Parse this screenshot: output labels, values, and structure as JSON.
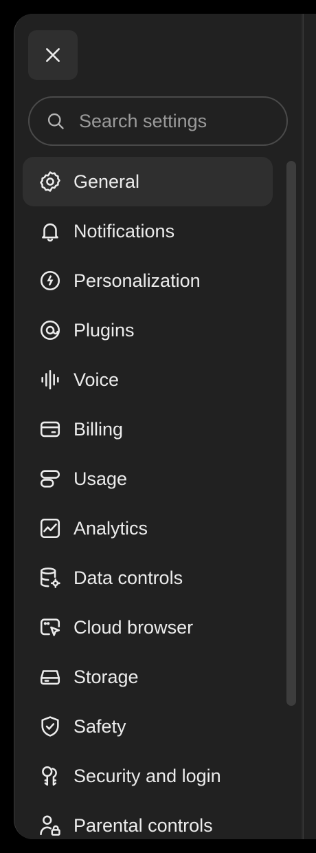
{
  "close_button": {
    "icon": "close-icon"
  },
  "search": {
    "placeholder": "Search settings",
    "value": "",
    "icon": "search-icon"
  },
  "nav": {
    "items": [
      {
        "label": "General",
        "icon": "gear-icon",
        "active": true
      },
      {
        "label": "Notifications",
        "icon": "bell-icon"
      },
      {
        "label": "Personalization",
        "icon": "personalization-icon"
      },
      {
        "label": "Plugins",
        "icon": "plugin-icon"
      },
      {
        "label": "Voice",
        "icon": "waveform-icon"
      },
      {
        "label": "Billing",
        "icon": "card-icon"
      },
      {
        "label": "Usage",
        "icon": "usage-icon"
      },
      {
        "label": "Analytics",
        "icon": "chart-icon"
      },
      {
        "label": "Data controls",
        "icon": "database-gear-icon"
      },
      {
        "label": "Cloud browser",
        "icon": "browser-cursor-icon"
      },
      {
        "label": "Storage",
        "icon": "drive-icon"
      },
      {
        "label": "Safety",
        "icon": "shield-check-icon"
      },
      {
        "label": "Security and login",
        "icon": "keys-icon"
      },
      {
        "label": "Parental controls",
        "icon": "person-lock-icon"
      }
    ]
  },
  "colors": {
    "background": "#212121",
    "active_item": "#2f2f2f",
    "text": "#ececec",
    "placeholder": "#9b9b9b"
  }
}
